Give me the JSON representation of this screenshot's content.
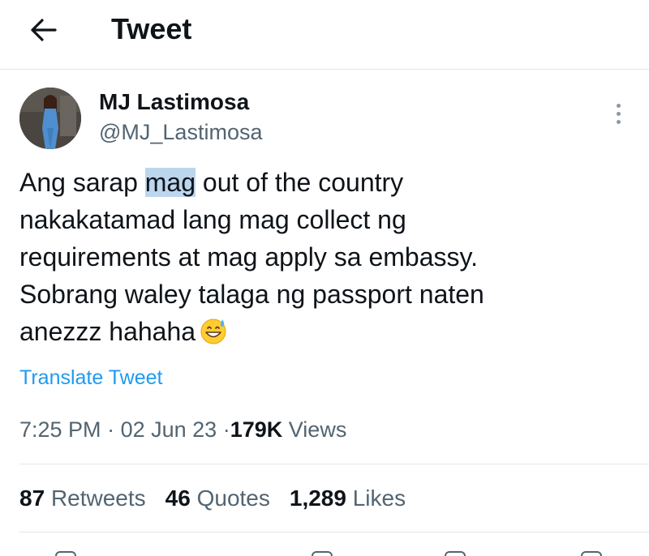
{
  "header": {
    "title": "Tweet",
    "back_icon": "arrow-left-icon"
  },
  "author": {
    "display_name": "MJ Lastimosa",
    "handle": "@MJ_Lastimosa"
  },
  "tweet": {
    "text_before_highlight": "Ang sarap ",
    "highlighted_word": "mag",
    "text_after_highlight": " out of the country\nnakakatamad lang mag collect ng\nrequirements at mag apply sa embassy.\nSobrang waley talaga ng passport naten\nanezzz hahaha",
    "emoji": "grinning-face-with-sweat-icon"
  },
  "translate_label": "Translate Tweet",
  "meta": {
    "time": "7:25 PM",
    "separator": "·",
    "date": "02 Jun 23",
    "views_count": "179K",
    "views_label": "Views"
  },
  "stats": {
    "retweets_count": "87",
    "retweets_label": "Retweets",
    "quotes_count": "46",
    "quotes_label": "Quotes",
    "likes_count": "1,289",
    "likes_label": "Likes"
  },
  "colors": {
    "accent": "#1d9bf0",
    "secondary_text": "#536471",
    "highlight": "#bcd6ee"
  }
}
